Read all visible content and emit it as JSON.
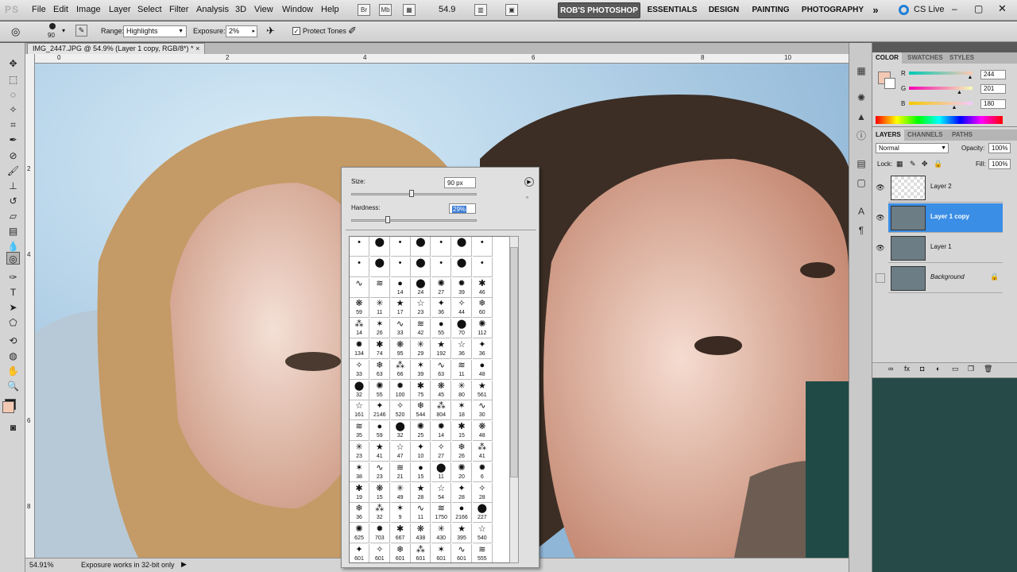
{
  "app": {
    "logo": "PS"
  },
  "menu": [
    "File",
    "Edit",
    "Image",
    "Layer",
    "Select",
    "Filter",
    "Analysis",
    "3D",
    "View",
    "Window",
    "Help"
  ],
  "apptoolbar": {
    "br": "Br",
    "mb": "Mb",
    "zoom": "54.9"
  },
  "workspaces": {
    "active": "ROB'S PHOTOSHOP",
    "items": [
      "ESSENTIALS",
      "DESIGN",
      "PAINTING",
      "PHOTOGRAPHY"
    ],
    "more": "»",
    "cslive": "CS Live"
  },
  "options": {
    "brush_size": "90",
    "range_label": "Range:",
    "range_value": "Highlights",
    "exposure_label": "Exposure:",
    "exposure_value": "2%",
    "protect_tones": "Protect Tones"
  },
  "document": {
    "tab_title": "IMG_2447.JPG @ 54.9% (Layer 1 copy, RGB/8*) *",
    "close": "×",
    "ruler_top": [
      "0",
      "2",
      "4",
      "6",
      "8",
      "10"
    ],
    "ruler_left": [
      "2",
      "4",
      "6",
      "8"
    ]
  },
  "status": {
    "zoom": "54.91%",
    "message": "Exposure works in 32-bit only"
  },
  "brush_picker": {
    "size_label": "Size:",
    "size_value": "90 px",
    "hardness_label": "Hardness:",
    "hardness_value": "29%",
    "size_fraction": 0.48,
    "hardness_fraction": 0.29,
    "rows": [
      [
        "",
        "",
        "",
        "",
        "",
        ""
      ],
      [
        "",
        "",
        "",
        "",
        "",
        ""
      ],
      [
        "",
        "",
        "14",
        "24",
        "27",
        "39",
        "46"
      ],
      [
        "59",
        "11",
        "17",
        "23",
        "36",
        "44",
        "60"
      ],
      [
        "14",
        "26",
        "33",
        "42",
        "55",
        "70",
        "112"
      ],
      [
        "134",
        "74",
        "95",
        "29",
        "192",
        "36",
        "36"
      ],
      [
        "33",
        "63",
        "66",
        "39",
        "63",
        "11",
        "48"
      ],
      [
        "32",
        "55",
        "100",
        "75",
        "45",
        "80",
        "561"
      ],
      [
        "161",
        "2146",
        "520",
        "544",
        "804",
        "18",
        "30"
      ],
      [
        "35",
        "59",
        "32",
        "25",
        "14",
        "15",
        "48"
      ],
      [
        "23",
        "41",
        "47",
        "10",
        "27",
        "26",
        "41"
      ],
      [
        "38",
        "23",
        "21",
        "15",
        "11",
        "20",
        "6"
      ],
      [
        "19",
        "15",
        "49",
        "28",
        "54",
        "28",
        "28"
      ],
      [
        "36",
        "32",
        "9",
        "11",
        "1750",
        "2166",
        "227"
      ],
      [
        "625",
        "703",
        "667",
        "438",
        "430",
        "395",
        "540"
      ],
      [
        "601",
        "601",
        "601",
        "601",
        "601",
        "601",
        "555"
      ]
    ]
  },
  "color_panel": {
    "tabs": [
      "COLOR",
      "SWATCHES",
      "STYLES"
    ],
    "r_label": "R",
    "g_label": "G",
    "b_label": "B",
    "r": "244",
    "g": "201",
    "b": "180",
    "r_fraction": 0.957,
    "g_fraction": 0.788,
    "b_fraction": 0.706,
    "foreground": "#f4c9b4"
  },
  "layers_panel": {
    "tabs": [
      "LAYERS",
      "CHANNELS",
      "PATHS"
    ],
    "blend_mode": "Normal",
    "opacity_label": "Opacity:",
    "opacity_value": "100%",
    "lock_label": "Lock:",
    "fill_label": "Fill:",
    "fill_value": "100%",
    "layers": [
      {
        "name": "Layer 2",
        "visible": true,
        "selected": false
      },
      {
        "name": "Layer 1 copy",
        "visible": true,
        "selected": true
      },
      {
        "name": "Layer 1",
        "visible": true,
        "selected": false
      },
      {
        "name": "Background",
        "visible": false,
        "selected": false
      }
    ]
  },
  "colors": {
    "selected_layer": "#3a8ee6",
    "workspace_active": "#5a5a5a"
  }
}
